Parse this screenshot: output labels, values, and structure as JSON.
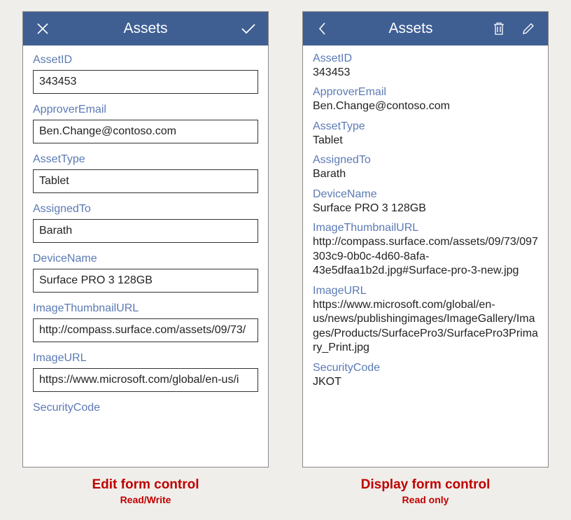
{
  "editForm": {
    "title": "Assets",
    "fields": {
      "assetId": {
        "label": "AssetID",
        "value": "343453"
      },
      "approverEmail": {
        "label": "ApproverEmail",
        "value": "Ben.Change@contoso.com"
      },
      "assetType": {
        "label": "AssetType",
        "value": "Tablet"
      },
      "assignedTo": {
        "label": "AssignedTo",
        "value": "Barath"
      },
      "deviceName": {
        "label": "DeviceName",
        "value": "Surface PRO 3 128GB"
      },
      "imageThumbnailUrl": {
        "label": "ImageThumbnailURL",
        "value": "http://compass.surface.com/assets/09/73/"
      },
      "imageUrl": {
        "label": "ImageURL",
        "value": "https://www.microsoft.com/global/en-us/i"
      },
      "securityCode": {
        "label": "SecurityCode"
      }
    }
  },
  "displayForm": {
    "title": "Assets",
    "fields": {
      "assetId": {
        "label": "AssetID",
        "value": "343453"
      },
      "approverEmail": {
        "label": "ApproverEmail",
        "value": "Ben.Change@contoso.com"
      },
      "assetType": {
        "label": "AssetType",
        "value": "Tablet"
      },
      "assignedTo": {
        "label": "AssignedTo",
        "value": "Barath"
      },
      "deviceName": {
        "label": "DeviceName",
        "value": "Surface PRO 3 128GB"
      },
      "imageThumbnailUrl": {
        "label": "ImageThumbnailURL",
        "value": "http://compass.surface.com/assets/09/73/097303c9-0b0c-4d60-8afa-43e5dfaa1b2d.jpg#Surface-pro-3-new.jpg"
      },
      "imageUrl": {
        "label": "ImageURL",
        "value": "https://www.microsoft.com/global/en-us/news/publishingimages/ImageGallery/Images/Products/SurfacePro3/SurfacePro3Primary_Print.jpg"
      },
      "securityCode": {
        "label": "SecurityCode",
        "value": "JKOT"
      }
    }
  },
  "captions": {
    "edit": {
      "main": "Edit form control",
      "sub": "Read/Write"
    },
    "display": {
      "main": "Display form control",
      "sub": "Read only"
    }
  }
}
